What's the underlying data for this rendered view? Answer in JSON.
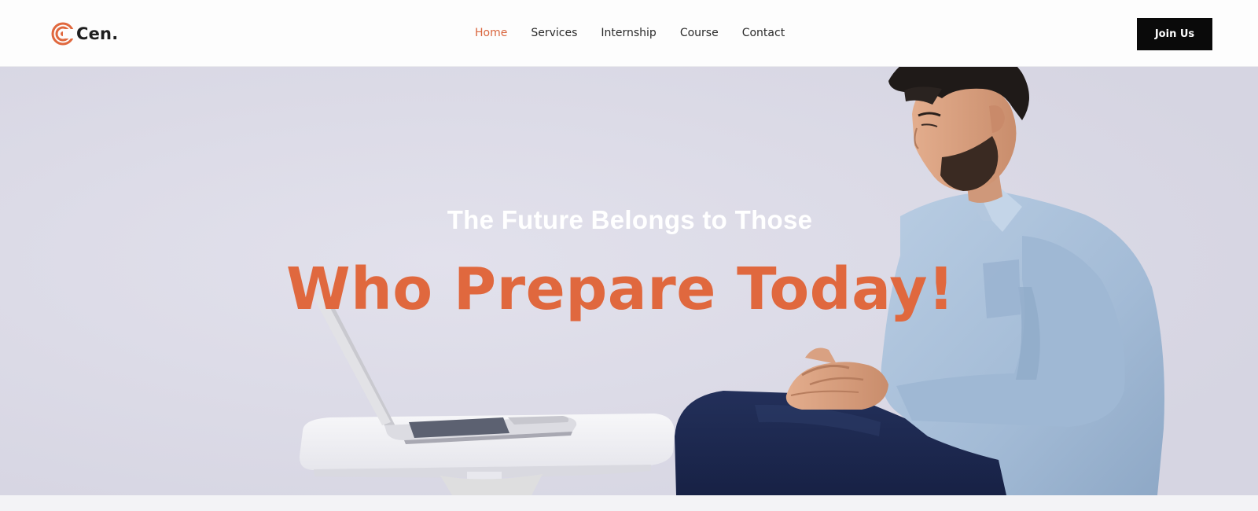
{
  "brand": {
    "logo_text": "Cen.",
    "logo_icon": "target-rings-icon",
    "accent_color": "#e0683e"
  },
  "nav": {
    "items": [
      {
        "label": "Home",
        "active": true
      },
      {
        "label": "Services",
        "active": false
      },
      {
        "label": "Internship",
        "active": false
      },
      {
        "label": "Course",
        "active": false
      },
      {
        "label": "Contact",
        "active": false
      }
    ]
  },
  "header": {
    "cta_label": "Join Us"
  },
  "hero": {
    "subtitle": "The Future Belongs to Those",
    "title": "Who Prepare Today!",
    "image_subject": "man-with-laptop-photo"
  }
}
